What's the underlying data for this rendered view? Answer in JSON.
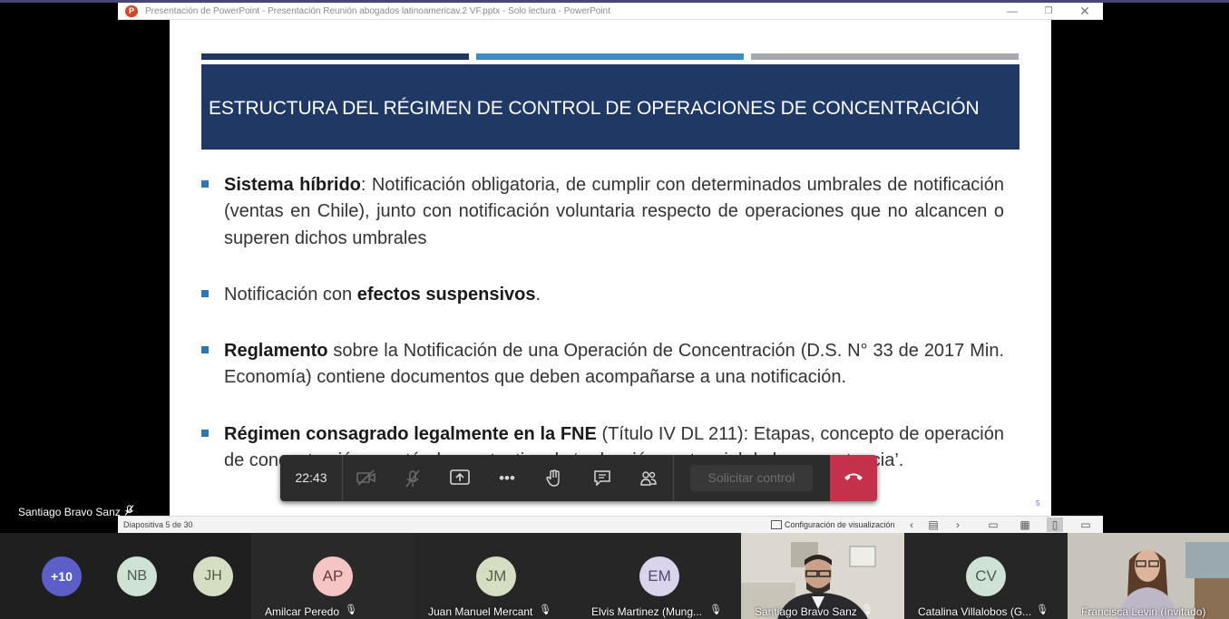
{
  "window": {
    "app_icon": "P",
    "title": "Presentación de PowerPoint  -  Presentación Reunión abogados latinoamericav.2 VF.pptx  -  Solo lectura - PowerPoint",
    "min": "—",
    "max": "❐",
    "close": "✕"
  },
  "slide": {
    "title": "ESTRUCTURA DEL RÉGIMEN DE CONTROL DE OPERACIONES DE CONCENTRACIÓN",
    "number": "5",
    "bullets": [
      {
        "bold": "Sistema híbrido",
        "text": ": Notificación obligatoria, de cumplir con determinados umbrales de notificación (ventas en Chile), junto con notificación voluntaria respecto de operaciones que no alcancen o superen dichos umbrales"
      },
      {
        "pre": "Notificación con ",
        "bold": "efectos suspensivos",
        "text": "."
      },
      {
        "bold": "Reglamento",
        "text": " sobre la Notificación de una Operación de Concentración (D.S. N° 33 de 2017 Min. Economía) contiene documentos que deben acompañarse a una notificación."
      },
      {
        "bold": "Régimen consagrado legalmente en la FNE",
        "text": " (Título IV DL 211): Etapas, concepto de operación de concentración, y estándar sustantivo de ‘reducción sustancial de la competencia’."
      }
    ]
  },
  "status_bar": {
    "slide_counter": "Diapositiva 5 de 30",
    "view_settings": "Configuración de visualización"
  },
  "meeting_controls": {
    "time": "22:43",
    "request_control": "Solicitar control"
  },
  "presenter": {
    "name": "Santiago Bravo Sanz"
  },
  "participants": {
    "overflow_count": "+10",
    "group_initials": [
      "NB",
      "JH"
    ],
    "tiles": [
      {
        "initials": "AP",
        "name": "Amilcar Peredo",
        "color": "#f4c5c4"
      },
      {
        "initials": "JM",
        "name": "Juan Manuel Mercant",
        "color": "#d5dec3"
      },
      {
        "initials": "EM",
        "name": "Elvis Martinez (Mung...",
        "color": "#d9d3ec"
      },
      {
        "initials": "CV",
        "name": "Catalina Villalobos (G...",
        "color": "#cfe2d6"
      }
    ],
    "video_tiles": [
      {
        "name": "Santiago Bravo Sanz"
      },
      {
        "name": "Francisca Levin (Invitado)"
      }
    ]
  },
  "colors": {
    "slide_navy": "#1f3864",
    "slide_blue": "#3a8ec6",
    "slide_grey": "#a5a8ad",
    "hangup_red": "#c4314b",
    "teams_purple": "#5b5fc7"
  }
}
